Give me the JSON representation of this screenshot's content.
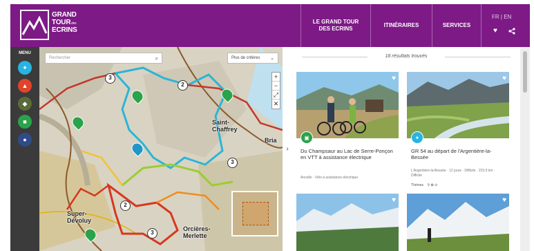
{
  "header": {
    "logo_lines": [
      "GRAND",
      "TOUR",
      "des",
      "ECRINS"
    ],
    "nav": [
      {
        "label_1": "LE GRAND TOUR",
        "label_2": "DES ECRINS"
      },
      {
        "label_1": "ITINÉRAIRES",
        "label_2": ""
      },
      {
        "label_1": "SERVICES",
        "label_2": ""
      }
    ],
    "lang_fr": "FR",
    "lang_sep": "|",
    "lang_en": "EN",
    "brand_color": "#7d1a86"
  },
  "side_menu": {
    "label": "MENU",
    "items": [
      {
        "icon": "hiking-icon",
        "color": "#29b3e0"
      },
      {
        "icon": "mountain-icon",
        "color": "#e0452b"
      },
      {
        "icon": "layers-icon",
        "color": "#5a6b3a"
      },
      {
        "icon": "hut-icon",
        "color": "#2aa34a"
      },
      {
        "icon": "circle-icon",
        "color": "#2f4b8a"
      }
    ]
  },
  "map": {
    "search_placeholder": "Rechercher",
    "filter_label": "Plus de critères",
    "zoom_in": "+",
    "zoom_out": "−",
    "fullscreen": "⤢",
    "close": "✕",
    "places": [
      "Saint-Chaffrey",
      "Orcières-Merlette",
      "Super-Dévoluy",
      "Bria"
    ],
    "stage_numbers": [
      "3",
      "2",
      "3",
      "2",
      "3"
    ]
  },
  "results": {
    "count_label": "18 résultats trouvés",
    "cards": [
      {
        "title": "Du Champsaur au Lac de Serre-Ponçon en VTT à assistance électrique",
        "meta": "Ancelle · Vélo à assistance électrique",
        "activity_icon": "bike-icon",
        "activity_color": "#2aa34a",
        "themes": ""
      },
      {
        "title": "GR 54 au départ de l'Argentière-la-Bessée",
        "meta": "L'Argentière-la-Bessée · 12 jours · Difficile · 223.9 km · Difficile",
        "activity_icon": "hiking-icon",
        "activity_color": "#29b3e0",
        "themes": "Thèmes"
      },
      {
        "title": "",
        "meta": "",
        "activity_icon": "",
        "activity_color": "",
        "themes": ""
      },
      {
        "title": "",
        "meta": "",
        "activity_icon": "",
        "activity_color": "",
        "themes": ""
      }
    ]
  }
}
